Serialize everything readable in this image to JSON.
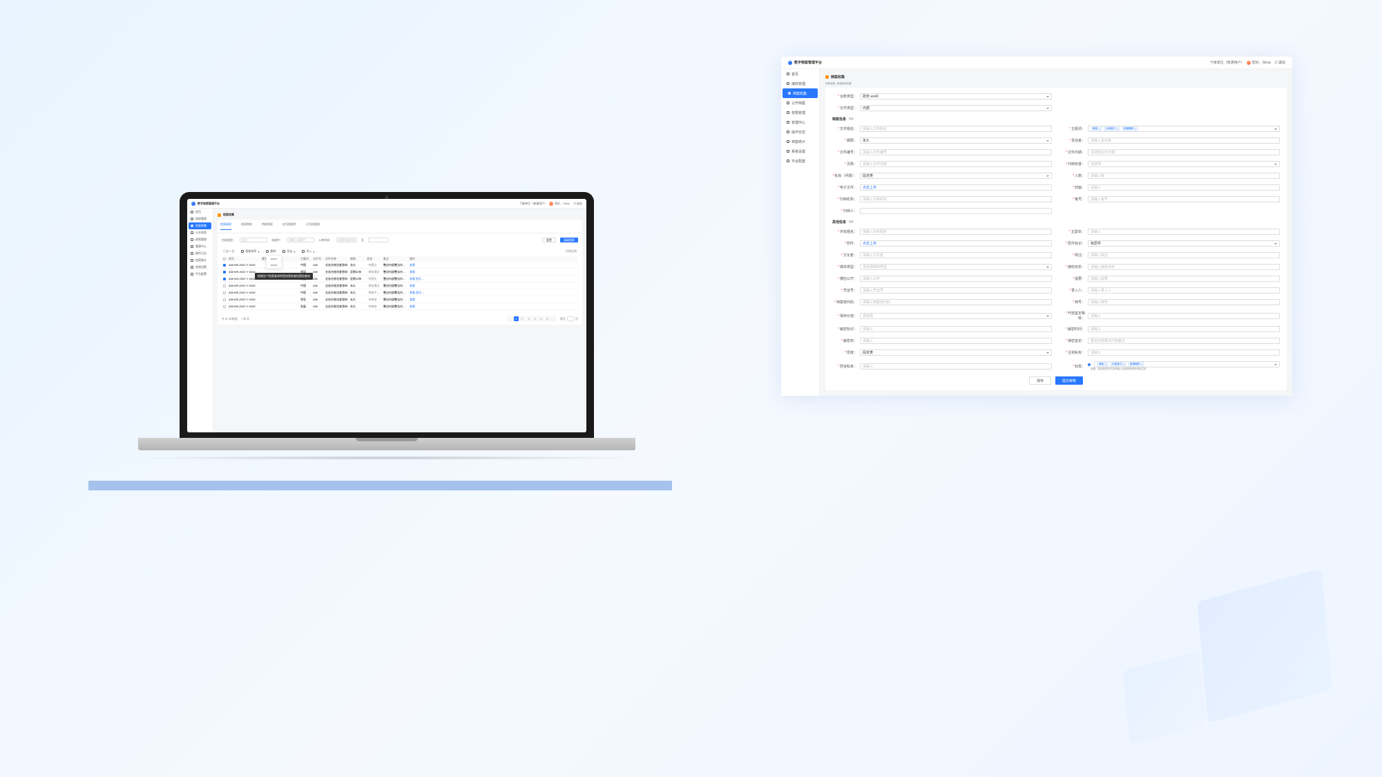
{
  "app": {
    "title": "数字档案管理平台",
    "org": "下级单位（普通用户）",
    "greeting": "您好，Silvia",
    "logout": "退出"
  },
  "sidebar": {
    "items": [
      {
        "icon": "home",
        "label": "首页"
      },
      {
        "icon": "grid",
        "label": "接收管理"
      },
      {
        "icon": "folder",
        "label": "档案收集",
        "active": true
      },
      {
        "icon": "open",
        "label": "公开档案"
      },
      {
        "icon": "tool",
        "label": "权限管理"
      },
      {
        "icon": "gear",
        "label": "管理中心"
      },
      {
        "icon": "log",
        "label": "操作日志"
      },
      {
        "icon": "chart",
        "label": "档案统计"
      },
      {
        "icon": "cog",
        "label": "系统设置"
      },
      {
        "icon": "cube",
        "label": "平台配置"
      }
    ]
  },
  "listPage": {
    "title": "档案收集",
    "tabs": [
      "档案接收",
      "档案审核",
      "特校档案",
      "应归档案件",
      "已归档案卷"
    ],
    "activeTab": 0,
    "filters": {
      "type_label": "台账类型：",
      "type_value": "全部",
      "keyword_label": "关键字：",
      "keyword_ph": "请输入关键字",
      "archiver_label": "入库时间：",
      "date_from": "选择开始时间",
      "date_to": "",
      "to": "至",
      "reset": "重置",
      "search": "高级搜索"
    },
    "toolbar": {
      "smart": "智能排序",
      "delete": "删除",
      "export": "导出",
      "import": "导入",
      "export_options": [
        "word",
        "excel"
      ]
    },
    "list_label": "已选 0 条",
    "columns_config": "列表定制",
    "columns": [
      "",
      "档号",
      "题名",
      "主题词",
      "文件号",
      "文件名称",
      "期限",
      "状态",
      "备注",
      "操作"
    ],
    "rows": [
      {
        "chk": true,
        "c1": "438·WS.2022·Y·0432",
        "c2": "",
        "c3": "中国",
        "c4": "438",
        "c5": "业务台账览查答辩",
        "c6": "永久",
        "c7": "待提交",
        "c8": "整治内部整法内容备注",
        "op": [
          "查看"
        ]
      },
      {
        "chk": true,
        "c1": "438·WS.2022·Y·0432",
        "c2": "",
        "c3": "领导",
        "c4": "438",
        "c5": "业务台账览查答辩",
        "c6": "定期30年",
        "c7": "审核通过",
        "c8": "整治内部整法内容备注",
        "op": [
          "查看"
        ],
        "tooltip": "结果这个档案查询的是档案档查档案档查档"
      },
      {
        "chk": true,
        "c1": "438·WS.2022·Y·0432",
        "c2": "",
        "c3": "发展",
        "c4": "438",
        "c5": "业务台账览查答辩",
        "c6": "定期10年",
        "c7": "待提交",
        "c8": "整治内部整法内容备注",
        "op": [
          "查看",
          "提交审核"
        ]
      },
      {
        "chk": false,
        "c1": "438·WS.2022·Y·0432",
        "c2": "",
        "c3": "中国",
        "c4": "438",
        "c5": "业务台账览查答辩",
        "c6": "永久",
        "c7": "审核通过",
        "c8": "整治内部整法内容备注",
        "op": [
          "查看"
        ]
      },
      {
        "chk": false,
        "c1": "438·WS.2022·Y·0432",
        "c2": "",
        "c3": "中国",
        "c4": "438",
        "c5": "业务台账览查答辩",
        "c6": "永久",
        "c7": "审核不通过",
        "c8": "整治内部整法内容备注",
        "op": [
          "查看",
          "提交审核"
        ]
      },
      {
        "chk": false,
        "c1": "438·WS.2022·Y·0432",
        "c2": "",
        "c3": "领导",
        "c4": "438",
        "c5": "业务台账览查答辩",
        "c6": "永久",
        "c7": "待审核",
        "c8": "整治内部整法内容备注",
        "op": [
          "查看"
        ]
      },
      {
        "chk": false,
        "c1": "438·WS.2022·Y·0432",
        "c2": "",
        "c3": "发展",
        "c4": "438",
        "c5": "业务台账览查答辩",
        "c6": "永久",
        "c7": "待审核",
        "c8": "整治内部整法内容备注",
        "op": [
          "查看"
        ]
      }
    ],
    "pager": {
      "total": "共 80 条数据",
      "per": "7 条/页",
      "pages": [
        "1",
        "2",
        "3",
        "4",
        "5",
        "6"
      ],
      "jump": "跳至",
      "page_unit": "页"
    }
  },
  "formPage": {
    "title": "档案收集",
    "breadcrumb": "档案收集 / 新增档案收集",
    "top": [
      {
        "label": "台账类型",
        "value": "政务 ws42",
        "type": "select"
      },
      {
        "label": "文件类型",
        "value": "内部",
        "type": "select"
      }
    ],
    "section1": {
      "title": "档案信息",
      "pill": "收起"
    },
    "fields1": [
      [
        {
          "label": "文件题名",
          "ph": "请输入文件题名"
        },
        {
          "label": "主题词",
          "type": "tags",
          "tags": [
            "黄板",
            "大事演习",
            "新增略称"
          ]
        }
      ],
      [
        {
          "label": "期限",
          "value": "永久",
          "type": "select"
        },
        {
          "label": "责任者",
          "ph": "请输入责任者"
        }
      ],
      [
        {
          "label": "文件编号",
          "ph": "请输入文件编号"
        },
        {
          "label": "文件日期",
          "ph": "请选择文件日期"
        }
      ],
      [
        {
          "label": "页数",
          "ph": "请输入文件页数"
        },
        {
          "label": "归档年度",
          "type": "select",
          "ph": "请选择"
        }
      ],
      [
        {
          "label": "私有（问题）",
          "value": "段定类",
          "type": "select"
        },
        {
          "label": "入数",
          "ph": "请输入数"
        }
      ],
      [
        {
          "label": "电子文件",
          "value": "点击上传",
          "type": "link"
        },
        {
          "label": "封面",
          "ph": "请输入"
        }
      ],
      [
        {
          "label": "归档机构",
          "ph": "请输入归档机构"
        },
        {
          "label": "格号",
          "ph": "请输入格号"
        }
      ],
      [
        {
          "label": "归档人",
          "ph": ""
        }
      ]
    ],
    "section2": {
      "title": "其他信息",
      "pill": "收起"
    },
    "fields2": [
      [
        {
          "label": "共有题名",
          "ph": "请输入共有题名"
        },
        {
          "label": "正副本",
          "ph": "请输入"
        }
      ],
      [
        {
          "label": "附件",
          "value": "点击上传",
          "type": "link"
        },
        {
          "label": "原件标识",
          "value": "有原件",
          "type": "select"
        }
      ],
      [
        {
          "label": "文化者",
          "ph": "请输入文化者"
        },
        {
          "label": "简注",
          "ph": "请输入简注"
        }
      ],
      [
        {
          "label": "媒体类型",
          "ph": "请选择媒体类型",
          "type": "select"
        },
        {
          "label": "接收状态",
          "ph": "请输入接收状态"
        }
      ],
      [
        {
          "label": "摘捡公开",
          "ph": "请输入公开"
        },
        {
          "label": "提要",
          "ph": "请输入提要"
        }
      ],
      [
        {
          "label": "凭证号",
          "ph": "请输入凭证号"
        },
        {
          "label": "录入人",
          "ph": "请输入录入人"
        }
      ],
      [
        {
          "label": "档案馆代码",
          "ph": "请输入档案馆代码"
        },
        {
          "label": "档号",
          "ph": "请输入档号"
        }
      ],
      [
        {
          "label": "保存价值",
          "ph": "请选择",
          "type": "select"
        },
        {
          "label": "开放鉴定等级",
          "ph": "请输入"
        }
      ],
      [
        {
          "label": "解密标识",
          "ph": "请输入"
        },
        {
          "label": "解密时间",
          "ph": "请输入"
        }
      ],
      [
        {
          "label": "解密权",
          "ph": "请输入"
        },
        {
          "label": "保密鉴定",
          "ph": "整治内部整法内容备注"
        }
      ],
      [
        {
          "label": "厚度",
          "value": "段定类",
          "type": "select"
        },
        {
          "label": "注资私有",
          "ph": "请输入"
        }
      ],
      [
        {
          "label": "舒适私有",
          "ph": "请输入"
        },
        {
          "label": "标签",
          "type": "tags-radio",
          "tags": [
            "黄板",
            "大事演习",
            "新增略称"
          ],
          "hint": "如需，如该标签无内容请输入后到表单填写则标生效"
        }
      ]
    ],
    "footer": {
      "save": "保存",
      "submit": "提交审核"
    }
  }
}
